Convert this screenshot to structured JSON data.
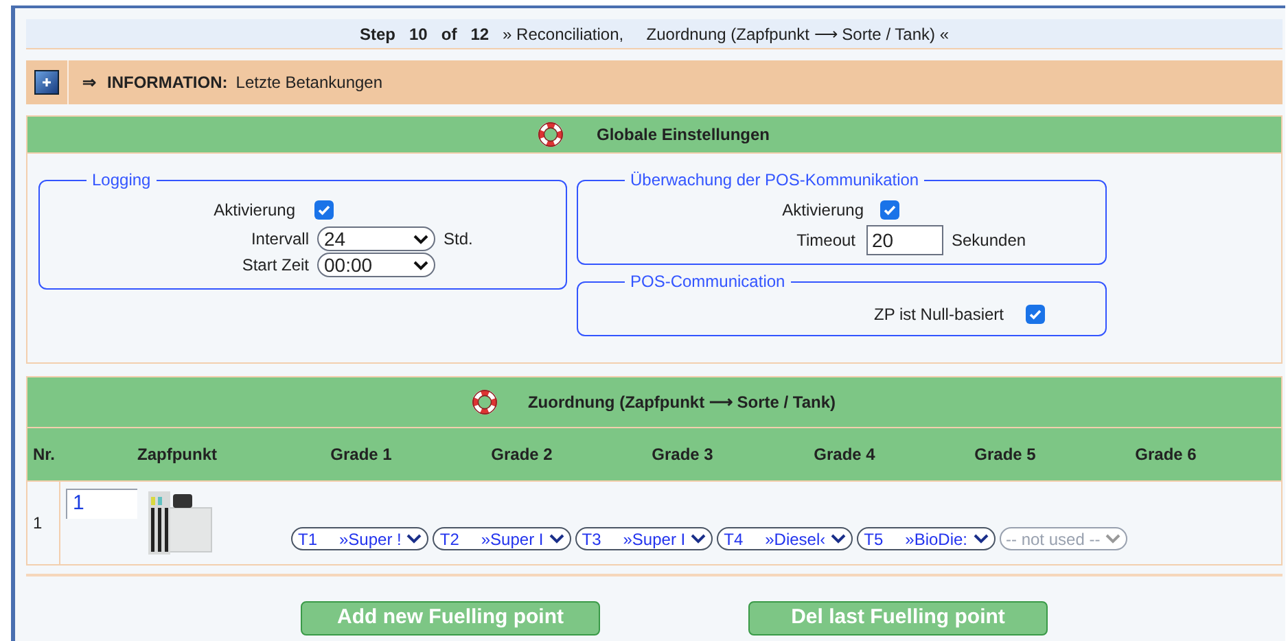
{
  "step_bar": {
    "step_label": "Step",
    "step": "10",
    "of_label": "of",
    "total": "12",
    "text": "» Reconciliation,     Zuordnung (Zapfpunkt ⟶ Sorte / Tank) «"
  },
  "info_bar": {
    "arrow": "⇒",
    "label": "INFORMATION:",
    "text": "Letzte Betankungen",
    "expanded": false
  },
  "global_settings": {
    "title": "Globale Einstellungen",
    "logging": {
      "legend": "Logging",
      "activation_label": "Aktivierung",
      "activation_checked": true,
      "interval_label": "Intervall",
      "interval_value": "24",
      "interval_unit": "Std.",
      "start_label": "Start Zeit",
      "start_value": "00:00"
    },
    "pos_monitoring": {
      "legend": "Überwachung der POS-Kommunikation",
      "activation_label": "Aktivierung",
      "activation_checked": true,
      "timeout_label": "Timeout",
      "timeout_value": "20",
      "timeout_unit": "Sekunden"
    },
    "pos_communication": {
      "legend": "POS-Communication",
      "zero_based_label": "ZP ist Null-basiert",
      "zero_based_checked": true
    }
  },
  "assignment": {
    "title": "Zuordnung (Zapfpunkt ⟶ Sorte / Tank)",
    "columns": [
      "Nr.",
      "Zapfpunkt",
      "Grade 1",
      "Grade 2",
      "Grade 3",
      "Grade 4",
      "Grade 5",
      "Grade 6"
    ],
    "rows": [
      {
        "nr": "1",
        "fuelling_point": "1",
        "grades": [
          {
            "tank": "T1",
            "grade": "»Super !",
            "disabled": false
          },
          {
            "tank": "T2",
            "grade": "»Super I",
            "disabled": false
          },
          {
            "tank": "T3",
            "grade": "»Super I",
            "disabled": false
          },
          {
            "tank": "T4",
            "grade": "»Diesel‹",
            "disabled": false
          },
          {
            "tank": "T5",
            "grade": "»BioDie:",
            "disabled": false
          },
          {
            "grade": "-- not used --",
            "disabled": true
          }
        ]
      }
    ]
  },
  "buttons": [
    "Add new Fuelling point",
    "Del last Fuelling point"
  ]
}
